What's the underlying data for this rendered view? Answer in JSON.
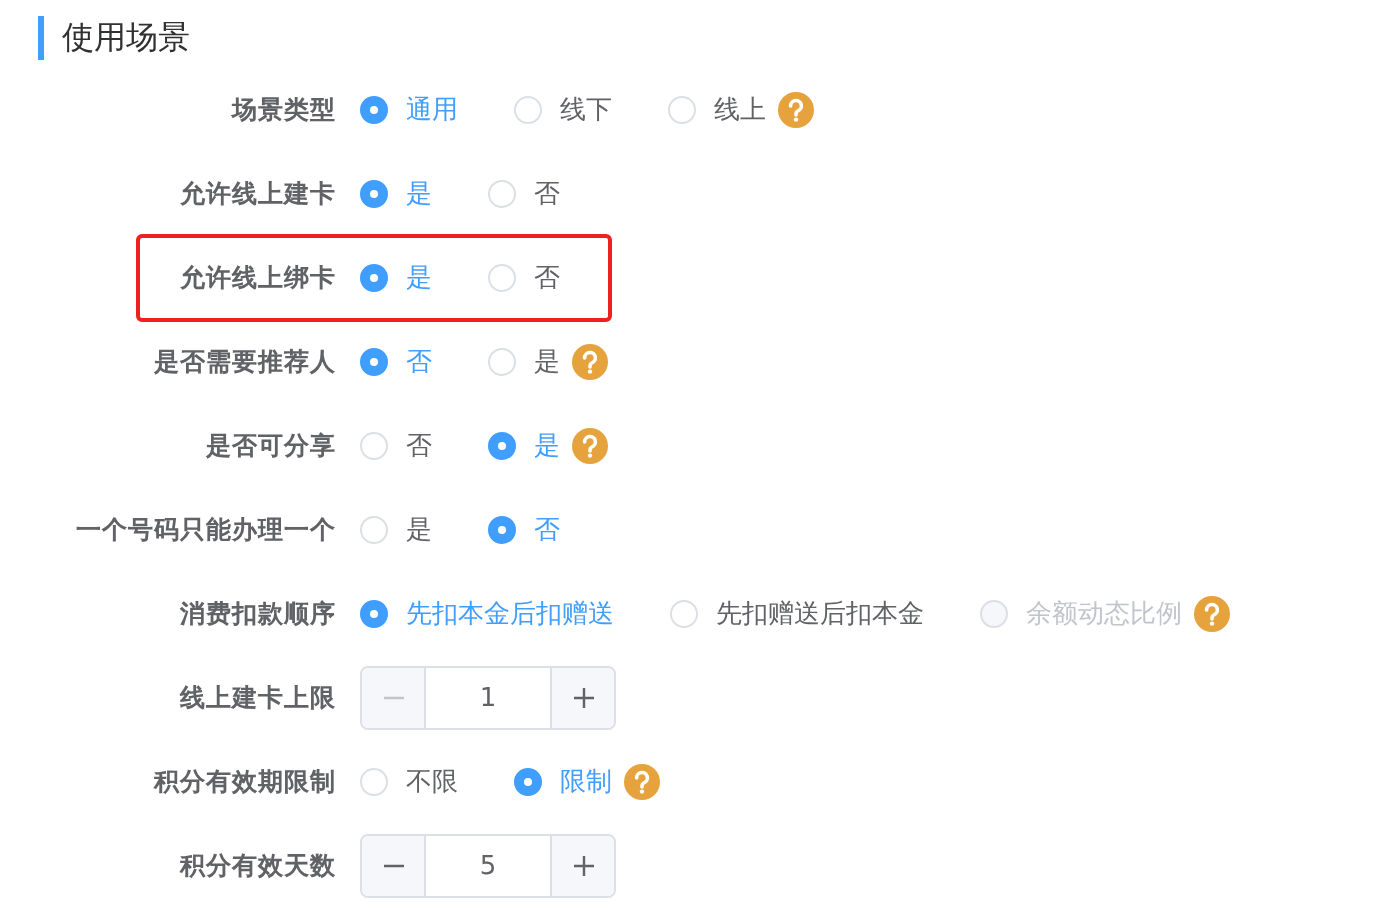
{
  "section": {
    "title": "使用场景"
  },
  "rows": [
    {
      "kind": "radio",
      "label": "场景类型",
      "options": [
        {
          "label": "通用",
          "selected": true,
          "disabled": false
        },
        {
          "label": "线下",
          "selected": false,
          "disabled": false
        },
        {
          "label": "线上",
          "selected": false,
          "disabled": false,
          "help": true
        }
      ]
    },
    {
      "kind": "radio",
      "label": "允许线上建卡",
      "options": [
        {
          "label": "是",
          "selected": true,
          "disabled": false
        },
        {
          "label": "否",
          "selected": false,
          "disabled": false
        }
      ]
    },
    {
      "kind": "radio",
      "label": "允许线上绑卡",
      "highlighted": true,
      "options": [
        {
          "label": "是",
          "selected": true,
          "disabled": false
        },
        {
          "label": "否",
          "selected": false,
          "disabled": false
        }
      ]
    },
    {
      "kind": "radio",
      "label": "是否需要推荐人",
      "options": [
        {
          "label": "否",
          "selected": true,
          "disabled": false
        },
        {
          "label": "是",
          "selected": false,
          "disabled": false,
          "help": true
        }
      ]
    },
    {
      "kind": "radio",
      "label": "是否可分享",
      "options": [
        {
          "label": "否",
          "selected": false,
          "disabled": false
        },
        {
          "label": "是",
          "selected": true,
          "disabled": false,
          "help": true
        }
      ]
    },
    {
      "kind": "radio",
      "label": "一个号码只能办理一个",
      "options": [
        {
          "label": "是",
          "selected": false,
          "disabled": false
        },
        {
          "label": "否",
          "selected": true,
          "disabled": false
        }
      ]
    },
    {
      "kind": "radio",
      "label": "消费扣款顺序",
      "options": [
        {
          "label": "先扣本金后扣赠送",
          "selected": true,
          "disabled": false
        },
        {
          "label": "先扣赠送后扣本金",
          "selected": false,
          "disabled": false
        },
        {
          "label": "余额动态比例",
          "selected": false,
          "disabled": true,
          "help": true
        }
      ]
    },
    {
      "kind": "stepper",
      "label": "线上建卡上限",
      "value": "1",
      "minus_disabled": true
    },
    {
      "kind": "radio",
      "label": "积分有效期限制",
      "options": [
        {
          "label": "不限",
          "selected": false,
          "disabled": false
        },
        {
          "label": "限制",
          "selected": true,
          "disabled": false,
          "help": true
        }
      ]
    },
    {
      "kind": "stepper",
      "label": "积分有效天数",
      "value": "5",
      "minus_disabled": false
    }
  ]
}
